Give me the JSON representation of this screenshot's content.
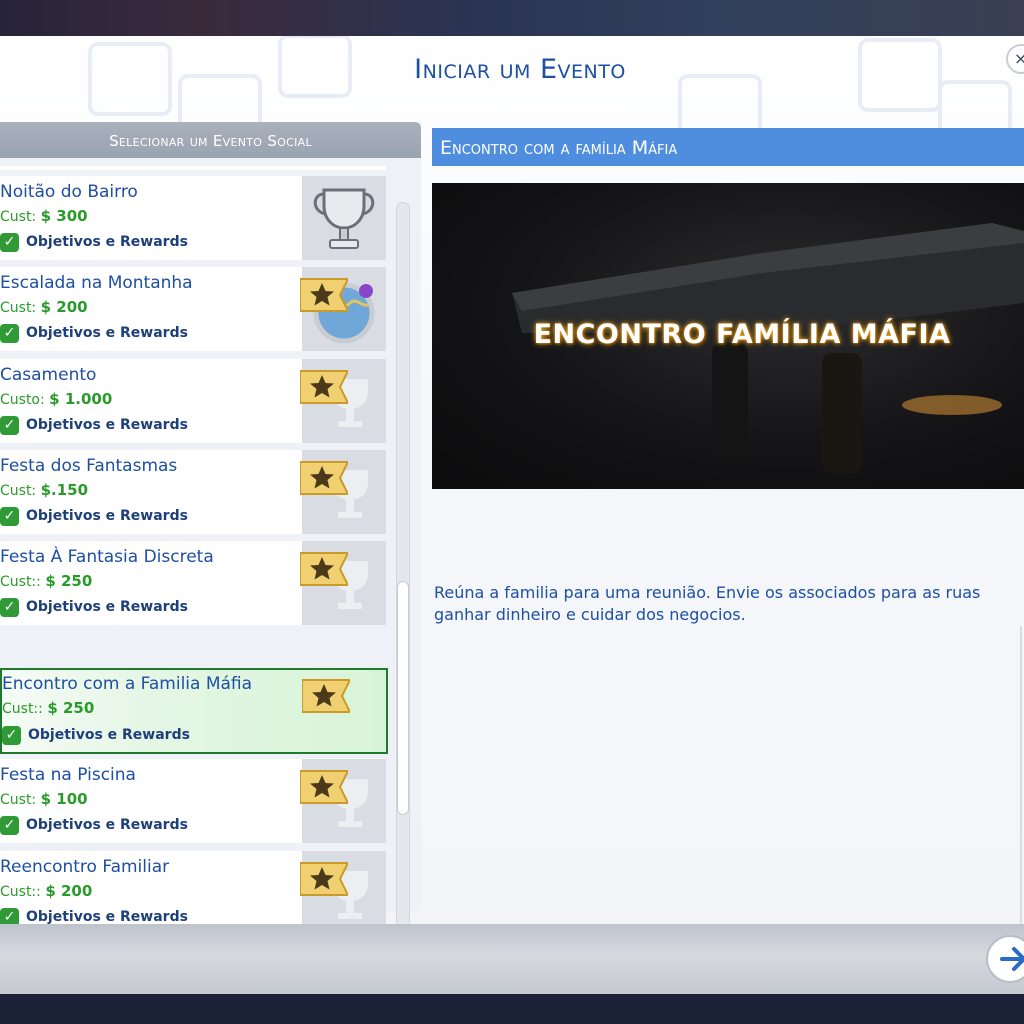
{
  "dialog": {
    "title": "Iniciar um Evento",
    "close_label": "×"
  },
  "list": {
    "header": "Selecionar um Evento Social",
    "items": [
      {
        "name": "Noitão do Bairro",
        "cost_label": "Cust:",
        "cost_value": "$ 300",
        "objectives": "Objetivos e Rewards",
        "thumb_icon": "trophy-icon",
        "selected": false
      },
      {
        "name": "Escalada na Montanha",
        "cost_label": "Cust:",
        "cost_value": "$ 200",
        "objectives": "Objetivos e Rewards",
        "thumb_icon": "globe-map-icon",
        "selected": false
      },
      {
        "name": "Casamento",
        "cost_label": "Custo:",
        "cost_value": "$ 1.000",
        "objectives": "Objetivos e Rewards",
        "thumb_icon": "trophy-icon",
        "selected": false
      },
      {
        "name": "Festa dos Fantasmas",
        "cost_label": "Cust:",
        "cost_value": "$.150",
        "objectives": "Objetivos e Rewards",
        "thumb_icon": "trophy-icon",
        "selected": false
      },
      {
        "name": "Festa À Fantasia Discreta",
        "cost_label": "Cust::",
        "cost_value": "$ 250",
        "objectives": "Objetivos e Rewards",
        "thumb_icon": "trophy-icon",
        "selected": false
      },
      {
        "name": "Encontro com a Familia Máfia",
        "cost_label": "Cust::",
        "cost_value": "$ 250",
        "objectives": "Objetivos e Rewards",
        "thumb_icon": "star-icon",
        "selected": true
      },
      {
        "name": "Festa na Piscina",
        "cost_label": "Cust:",
        "cost_value": "$ 100",
        "objectives": "Objetivos e Rewards",
        "thumb_icon": "trophy-icon",
        "selected": false
      },
      {
        "name": "Reencontro Familiar",
        "cost_label": "Cust::",
        "cost_value": "$ 200",
        "objectives": "Objetivos e Rewards",
        "thumb_icon": "trophy-icon",
        "selected": false
      }
    ]
  },
  "detail": {
    "title": "Encontro com a família Máfia",
    "banner_text": "ENCONTRO FAMÍLIA MÁFIA",
    "description": "Reúna a familia para uma reunião. Envie os associados para as ruas ganhar dinheiro e cuidar dos negocios."
  },
  "colors": {
    "accent_blue": "#1d4fa3",
    "title_bar_blue": "#4f8ede",
    "cost_green": "#2a9a2a",
    "selected_border": "#1f7a2d"
  },
  "icons": {
    "close": "close-icon",
    "next": "arrow-right-icon",
    "check": "checkmark-icon",
    "star": "star-icon"
  }
}
